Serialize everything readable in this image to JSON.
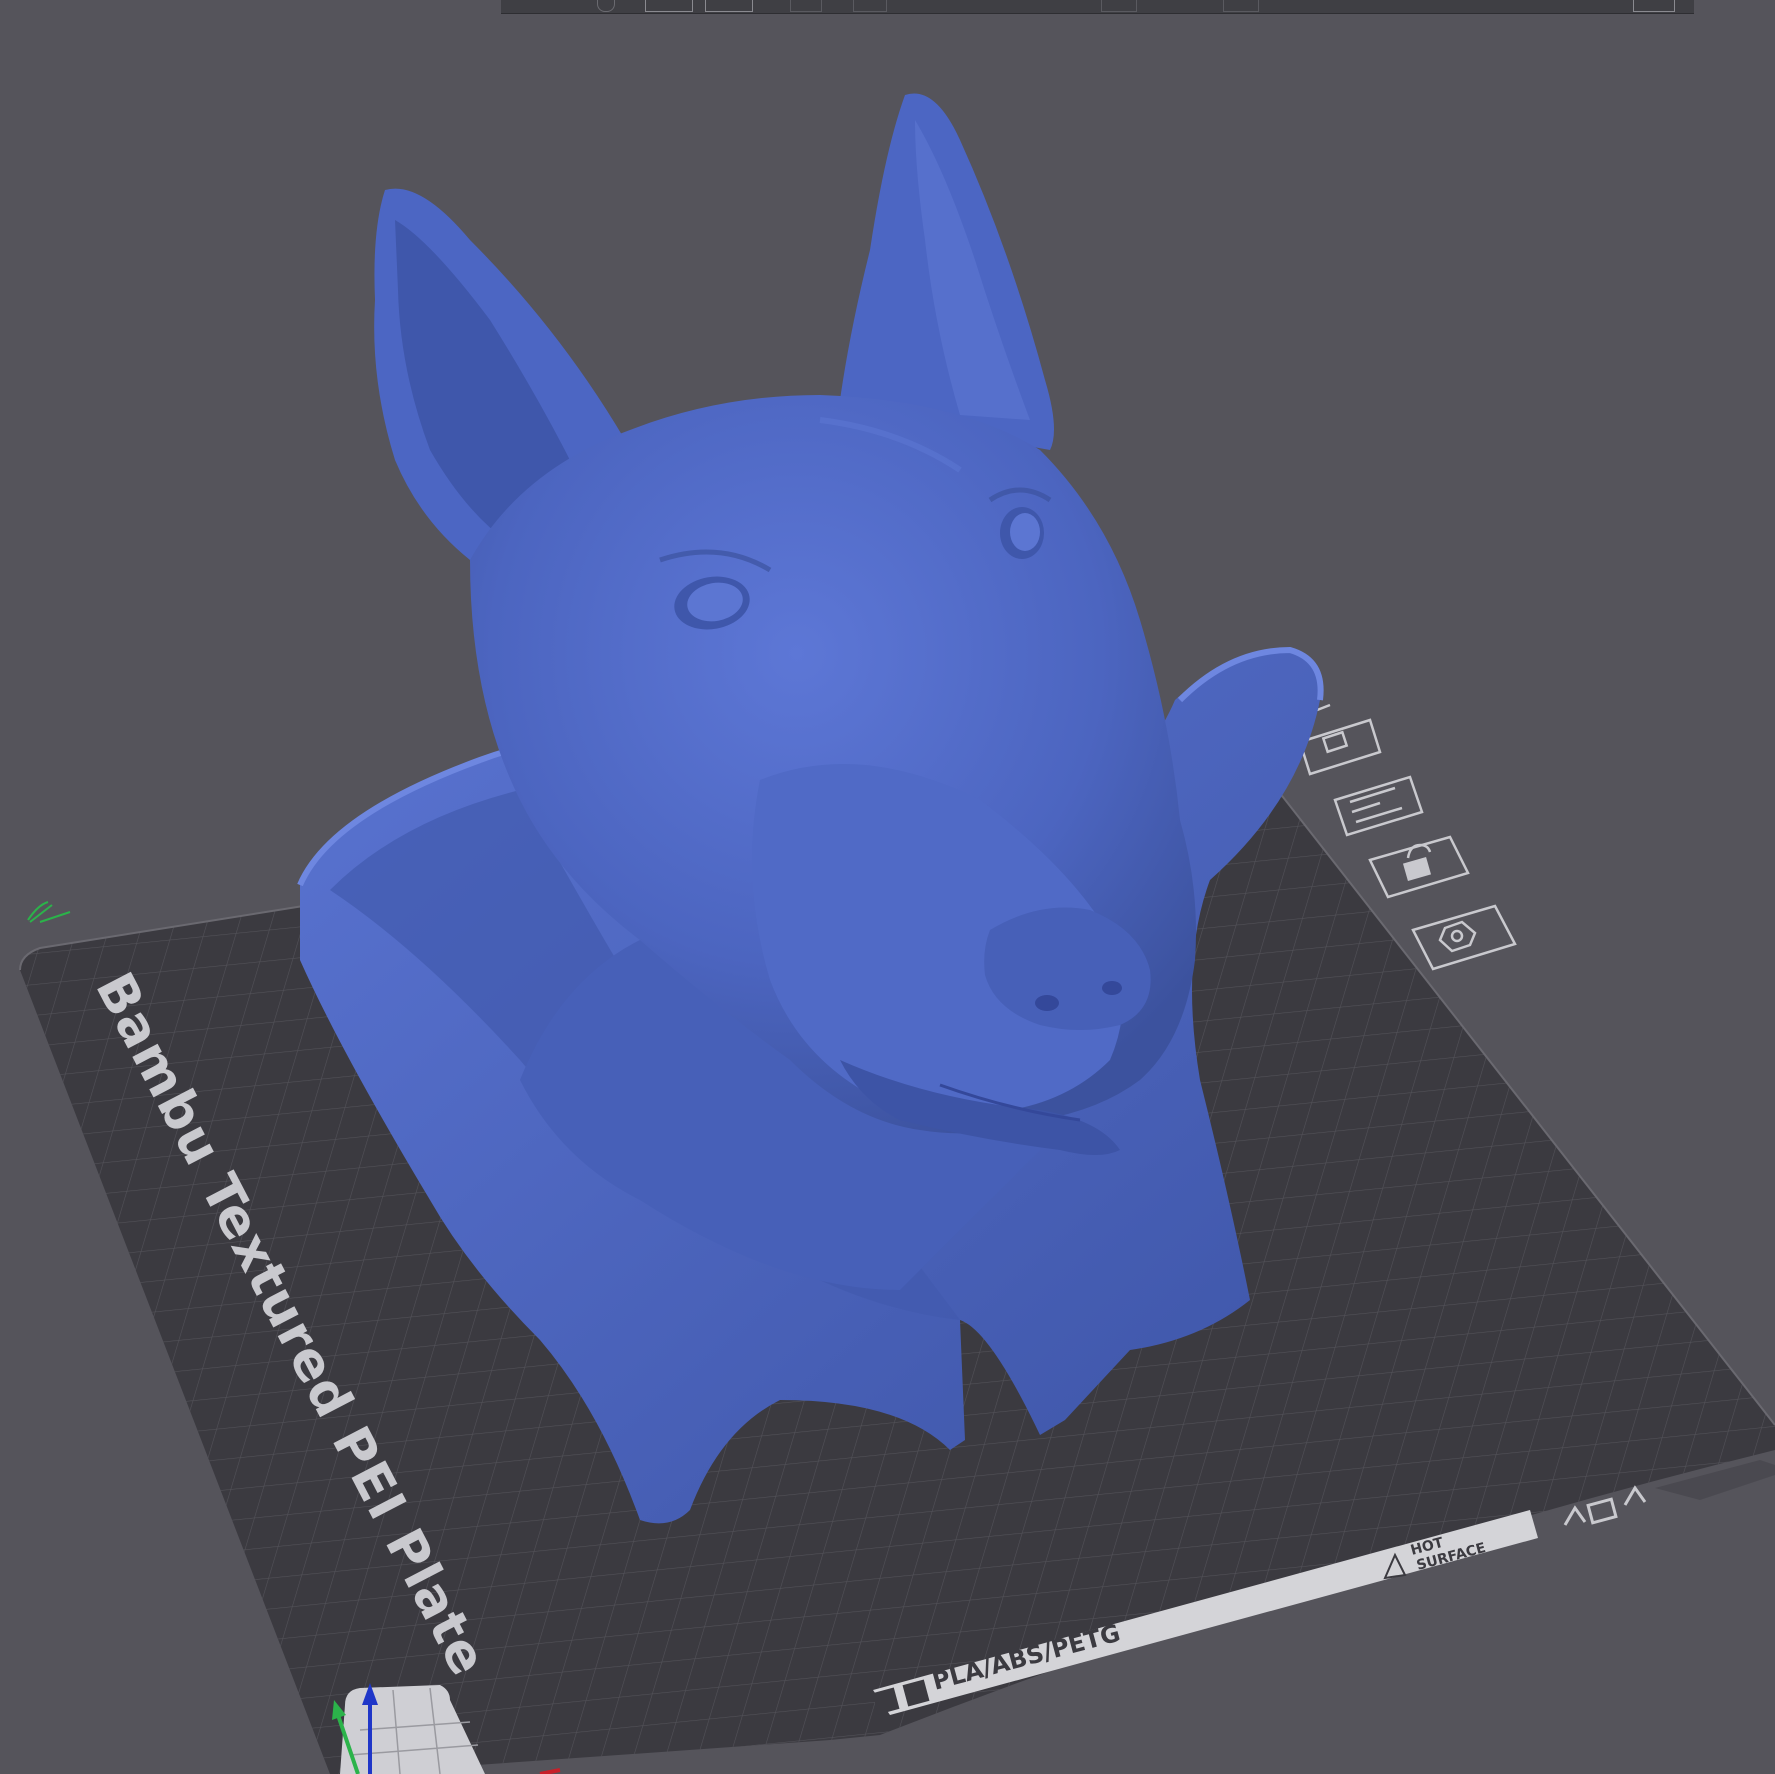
{
  "app": {
    "viewport_background": "#55545b",
    "plate_color": "#3b3a40",
    "model_color": "#4f68c2"
  },
  "plate": {
    "name": "Bambu Textured PEI Plate",
    "strip_text": "PLA/ABS/PETG",
    "hot_surface_line1": "HOT",
    "hot_surface_line2": "SURFACE"
  },
  "toolbar": {
    "icons": [
      "move-icon",
      "rotate-icon",
      "scale-icon",
      "cut-icon",
      "support-paint-icon",
      "seam-paint-icon",
      "color-paint-icon",
      "text-icon",
      "measure-icon",
      "layout-icon"
    ]
  },
  "plate_toolbar": {
    "icons": [
      "pick-plate-icon",
      "arrange-icon",
      "plate-settings-icon",
      "lock-icon",
      "slice-plate-icon"
    ]
  },
  "model": {
    "subject": "dog-bust"
  },
  "axes": {
    "x_color": "#c8202a",
    "y_color": "#2bb34a",
    "z_color": "#1f36c8"
  }
}
